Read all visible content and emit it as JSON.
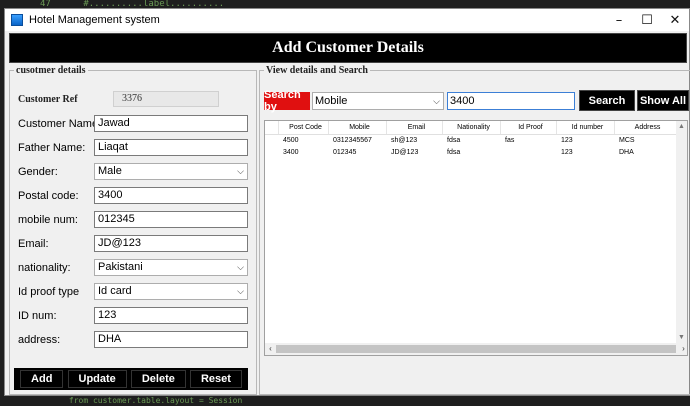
{
  "editor": {
    "top_line": "47      #..........label..........",
    "bottom_line": "      from customer.table.layout = Session"
  },
  "window": {
    "title": "Hotel Management system",
    "minimize_glyph": "–",
    "maximize_glyph": "☐",
    "close_glyph": "✕"
  },
  "header": {
    "title": "Add Customer Details"
  },
  "customer": {
    "legend": "cusotmer details",
    "ref_label": "Customer Ref",
    "ref_value": "3376",
    "fields": {
      "name": {
        "label": "Customer Name:",
        "value": "Jawad"
      },
      "father": {
        "label": "Father Name:",
        "value": "Liaqat"
      },
      "gender": {
        "label": "Gender:",
        "value": "Male"
      },
      "postal": {
        "label": "Postal code:",
        "value": "3400"
      },
      "mobile": {
        "label": "mobile num:",
        "value": "012345"
      },
      "email": {
        "label": "Email:",
        "value": "JD@123"
      },
      "nationality": {
        "label": "nationality:",
        "value": "Pakistani"
      },
      "idproof": {
        "label": "Id proof type",
        "value": "Id card"
      },
      "idnum": {
        "label": "ID num:",
        "value": "123"
      },
      "address": {
        "label": "address:",
        "value": "DHA"
      }
    },
    "buttons": {
      "add": "Add",
      "update": "Update",
      "delete": "Delete",
      "reset": "Reset"
    }
  },
  "search": {
    "legend": "View details and Search",
    "by_label": "Search by",
    "by_value": "Mobile",
    "input_value": "3400",
    "search_button": "Search",
    "show_all_button": "Show All"
  },
  "table": {
    "columns": [
      "",
      "Post Code",
      "Mobile",
      "Email",
      "Nationality",
      "Id Proof",
      "Id number",
      "Address"
    ],
    "rows": [
      [
        "",
        "4500",
        "0312345567",
        "sh@123",
        "fdsa",
        "fas",
        "123",
        "MCS"
      ],
      [
        "",
        "3400",
        "012345",
        "JD@123",
        "fdsa",
        "",
        "123",
        "DHA"
      ]
    ]
  }
}
